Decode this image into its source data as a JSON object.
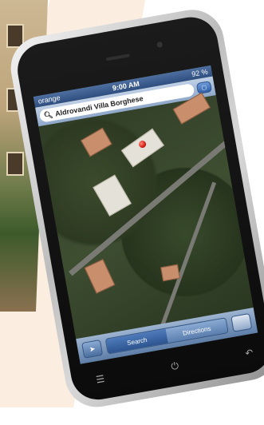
{
  "status_bar": {
    "carrier": "orange",
    "time": "9:00 AM",
    "battery": "92 %"
  },
  "search": {
    "query": "Aldrovandi Villa Borghese"
  },
  "toolbar": {
    "search_label": "Search",
    "directions_label": "Directions"
  },
  "icons": {
    "search": "magnifier",
    "bookmarks": "book",
    "locate": "arrow",
    "page_curl": "page-curl",
    "menu": "menu-key",
    "power": "power",
    "back": "back-arrow"
  },
  "colors": {
    "pin": "#d21c12",
    "bar_blue": "#2f4e80"
  }
}
